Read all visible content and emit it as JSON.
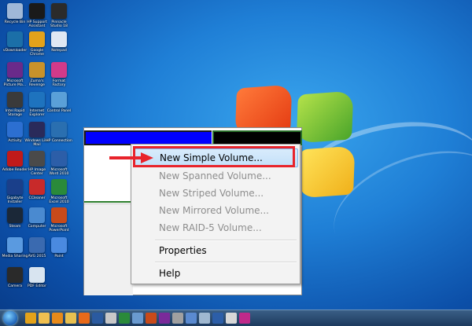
{
  "desktop": {
    "icons": [
      {
        "label": "Recycle Bin",
        "color": "#9fb8d8"
      },
      {
        "label": "HP Support Assistant",
        "color": "#1a1a1a"
      },
      {
        "label": "Pinnacle Studio 18",
        "color": "#2b2b2b"
      },
      {
        "label": "vDownloader",
        "color": "#1b6fa8"
      },
      {
        "label": "Google Chrome",
        "color": "#e3a21a"
      },
      {
        "label": "Notepad",
        "color": "#dfe8f3"
      },
      {
        "label": "Microsoft Picture Ma...",
        "color": "#6a2a8a"
      },
      {
        "label": "Zuma's Revenge",
        "color": "#c8922a"
      },
      {
        "label": "Format Factory",
        "color": "#d23a8a"
      },
      {
        "label": "Intel Rapid Storage",
        "color": "#3a3a3a"
      },
      {
        "label": "Internet Explorer",
        "color": "#1e73be"
      },
      {
        "label": "Control Panel",
        "color": "#5aa0d8"
      },
      {
        "label": "Activity",
        "color": "#2c6fd1"
      },
      {
        "label": "Windows Live Mail",
        "color": "#2a2a5a"
      },
      {
        "label": "HP Connection",
        "color": "#2a6fb0"
      },
      {
        "label": "Adobe Reader",
        "color": "#c01a1a"
      },
      {
        "label": "HP Image Center",
        "color": "#4a4a4a"
      },
      {
        "label": "Microsoft Word 2010",
        "color": "#2c5ea8"
      },
      {
        "label": "Gigabyte Installer",
        "color": "#1a3f8a"
      },
      {
        "label": "CCleaner",
        "color": "#c82a2a"
      },
      {
        "label": "Microsoft Excel 2010",
        "color": "#2a8a3a"
      },
      {
        "label": "Steam",
        "color": "#1b2838"
      },
      {
        "label": "Computer",
        "color": "#4a8ad0"
      },
      {
        "label": "Microsoft PowerPoint",
        "color": "#c84a1a"
      },
      {
        "label": "Media Sharing",
        "color": "#5a9ae0"
      },
      {
        "label": "AVG 2015",
        "color": "#3a6ab0"
      },
      {
        "label": "Paint",
        "color": "#4a8ae0"
      },
      {
        "label": "Camera",
        "color": "#2a2a2a"
      },
      {
        "label": "PDF Editor",
        "color": "#d8e4f0"
      }
    ]
  },
  "context_menu": {
    "items": [
      {
        "label": "New Simple Volume...",
        "enabled": true,
        "highlighted": true
      },
      {
        "label": "New Spanned Volume...",
        "enabled": false
      },
      {
        "label": "New Striped Volume...",
        "enabled": false
      },
      {
        "label": "New Mirrored Volume...",
        "enabled": false
      },
      {
        "label": "New RAID-5 Volume...",
        "enabled": false
      },
      {
        "label": "Properties",
        "enabled": true
      },
      {
        "label": "Help",
        "enabled": true
      }
    ]
  },
  "colors": {
    "highlight_border": "#e8232b",
    "volume_bar_primary": "#0000ff",
    "volume_bar_unallocated": "#000000"
  },
  "taskbar": {
    "apps": [
      {
        "icon": "chrome-icon",
        "color": "#e3a21a"
      },
      {
        "icon": "explorer-icon",
        "color": "#f0c050"
      },
      {
        "icon": "media-player-icon",
        "color": "#e88a1a"
      },
      {
        "icon": "folder-icon",
        "color": "#e8c050"
      },
      {
        "icon": "firefox-icon",
        "color": "#e86a1a"
      },
      {
        "icon": "video-icon",
        "color": "#2a5aa0"
      },
      {
        "icon": "app-icon",
        "color": "#c8c8c8"
      },
      {
        "icon": "excel-icon",
        "color": "#2a8a3a"
      },
      {
        "icon": "image-icon",
        "color": "#6a9ad0"
      },
      {
        "icon": "powerpoint-icon",
        "color": "#c84a1a"
      },
      {
        "icon": "onenote-icon",
        "color": "#7a2a9a"
      },
      {
        "icon": "network-icon",
        "color": "#a0a0a0"
      },
      {
        "icon": "photo-icon",
        "color": "#5a8ad0"
      },
      {
        "icon": "tool-icon",
        "color": "#a0b8d0"
      },
      {
        "icon": "word-icon",
        "color": "#2c5ea8"
      },
      {
        "icon": "media-icon",
        "color": "#d8d8d8"
      },
      {
        "icon": "pinnacle-icon",
        "color": "#c02a8a"
      }
    ]
  }
}
